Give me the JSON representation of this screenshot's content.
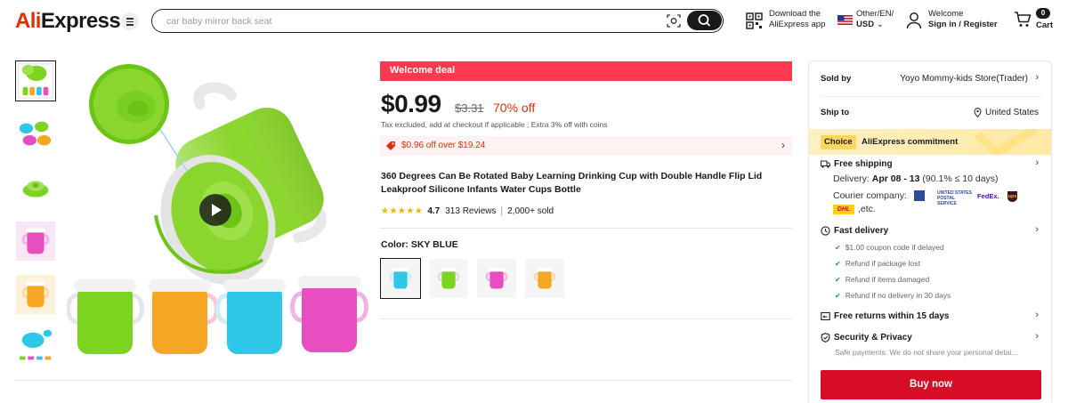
{
  "header": {
    "logo_ali": "Ali",
    "logo_express": "Express",
    "search_placeholder": "car baby mirror back seat",
    "app_line1": "Download the",
    "app_line2": "AliExpress app",
    "locale_line1": "Other/EN/",
    "locale_line2": "USD",
    "welcome": "Welcome",
    "signin": "Sign in / Register",
    "cart_count": "0",
    "cart_label": "Cart"
  },
  "gallery": {
    "thumb_count": 6,
    "selected_thumb": 0,
    "colors": [
      "#7ed321",
      "#2fc7e8",
      "#f5a623",
      "#e94ec0"
    ]
  },
  "product": {
    "deal_label": "Welcome deal",
    "price": "$0.99",
    "old_price": "$3.31",
    "discount": "70% off",
    "tax_note": "Tax excluded, add at checkout if applicable ; Extra 3% off with coins",
    "coupon_text": "$0.96 off over $19.24",
    "title": "360 Degrees Can Be Rotated Baby Learning Drinking Cup with Double Handle Flip Lid Leakproof Silicone Infants Water Cups Bottle",
    "stars": 4.7,
    "rating": "4.7",
    "reviews": "313 Reviews",
    "sold": "2,000+ sold",
    "color_label": "Color: SKY BLUE",
    "swatches": [
      "SKY BLUE",
      "GREEN",
      "PINK",
      "ORANGE"
    ]
  },
  "panel": {
    "sold_by_label": "Sold by",
    "store_name": "Yoyo Mommy-kids Store(Trader)",
    "ship_to_label": "Ship to",
    "ship_to_value": "United States",
    "choice_tag": "Choice",
    "choice_text": "AliExpress commitment",
    "free_shipping": "Free shipping",
    "delivery_prefix": "Delivery: ",
    "delivery_dates": "Apr 08 - 13",
    "delivery_suffix": " (90.1% ≤ 10 days)",
    "courier_label": "Courier company:",
    "courier_usps": "UNITED STATES POSTAL SERVICE",
    "courier_fedex": "FedEx.",
    "courier_ups": "ups",
    "courier_dhl": "DHL",
    "courier_etc": ",etc.",
    "fast_delivery": "Fast delivery",
    "fast_items": [
      "$1.00 coupon code if delayed",
      "Refund if package lost",
      "Refund if items damaged",
      "Refund if no delivery in 30 days"
    ],
    "free_returns": "Free returns within 15 days",
    "security": "Security & Privacy",
    "security_note": "Safe payments: We do not share your personal detai...",
    "buy_now": "Buy now"
  }
}
